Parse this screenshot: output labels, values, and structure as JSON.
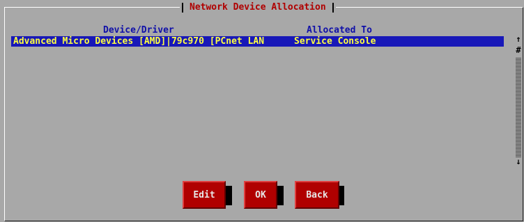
{
  "dialog": {
    "title": "Network Device Allocation"
  },
  "table": {
    "headers": [
      "Device/Driver",
      "Allocated To"
    ],
    "rows": [
      [
        "Advanced Micro Devices [AMD]|79c970 [PCnet LAN",
        "Service Console"
      ]
    ]
  },
  "scrollbar": {
    "up_icon": "arrow-up",
    "thumb_icon": "scroll-thumb",
    "down_icon": "arrow-down"
  },
  "buttons": {
    "edit": "Edit",
    "ok": "OK",
    "back": "Back"
  },
  "colors": {
    "background": "#a8a8a8",
    "title": "#b00000",
    "header": "#1010a8",
    "selection_bg": "#1818b8",
    "selection_fg": "#ffff40",
    "button_bg": "#b00000"
  }
}
